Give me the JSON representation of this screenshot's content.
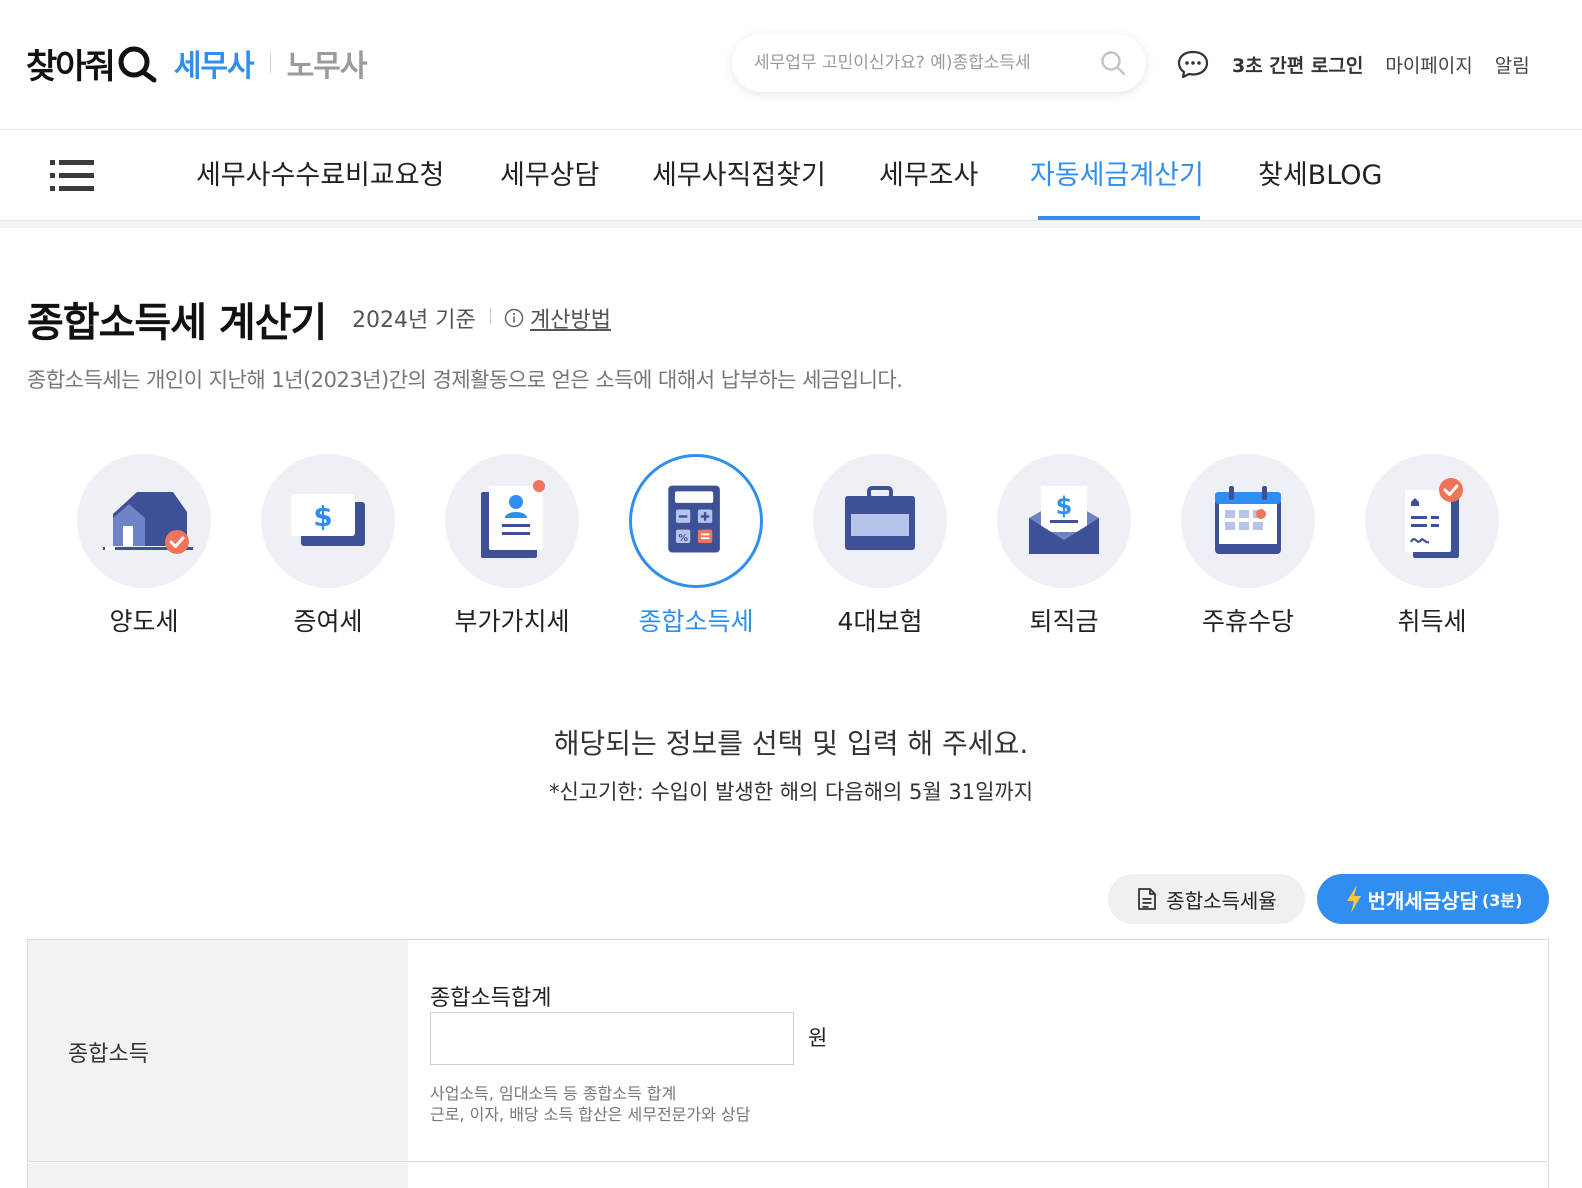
{
  "header": {
    "logo_main": "찾아줘",
    "logo_tax": "세무사",
    "logo_labor": "노무사",
    "search_placeholder": "세무업무 고민이신가요? 예)종합소득세",
    "login_label": "3초 간편 로그인",
    "mypage_label": "마이페이지",
    "alert_label": "알림"
  },
  "nav": {
    "items": [
      {
        "label": "세무사수수료비교요청"
      },
      {
        "label": "세무상담"
      },
      {
        "label": "세무사직접찾기"
      },
      {
        "label": "세무조사"
      },
      {
        "label": "자동세금계산기"
      },
      {
        "label": "찾세BLOG"
      }
    ],
    "active_index": 4
  },
  "page": {
    "title": "종합소득세 계산기",
    "year_basis": "2024년 기준",
    "method_link": "계산방법",
    "description": "종합소득세는 개인이 지난해 1년(2023년)간의 경제활동으로 얻은 소득에 대해서 납부하는 세금입니다."
  },
  "categories": [
    {
      "label": "양도세",
      "icon": "house-icon"
    },
    {
      "label": "증여세",
      "icon": "money-card-icon"
    },
    {
      "label": "부가가치세",
      "icon": "document-person-icon"
    },
    {
      "label": "종합소득세",
      "icon": "calculator-icon"
    },
    {
      "label": "4대보험",
      "icon": "briefcase-icon"
    },
    {
      "label": "퇴직금",
      "icon": "envelope-money-icon"
    },
    {
      "label": "주휴수당",
      "icon": "calendar-icon"
    },
    {
      "label": "취득세",
      "icon": "contract-check-icon"
    }
  ],
  "active_category": 3,
  "instructions": {
    "main": "해당되는 정보를 선택 및 입력 해 주세요.",
    "sub": "*신고기한: 수입이 발생한 해의 다음해의 5월 31일까지"
  },
  "buttons": {
    "rate_label": "종합소득세율",
    "consult_label": "번개세금상담",
    "consult_small": "(3분)"
  },
  "form": {
    "row_label": "종합소득",
    "field_label": "종합소득합계",
    "field_value": "",
    "unit": "원",
    "help_line1": "사업소득, 임대소득 등 종합소득 합계",
    "help_line2": "근로, 이자, 배당 소득 합산은 세무전문가와 상담"
  },
  "colors": {
    "accent": "#2f8ef0",
    "icon_navy": "#3f5196",
    "badge_orange": "#f0745a"
  }
}
